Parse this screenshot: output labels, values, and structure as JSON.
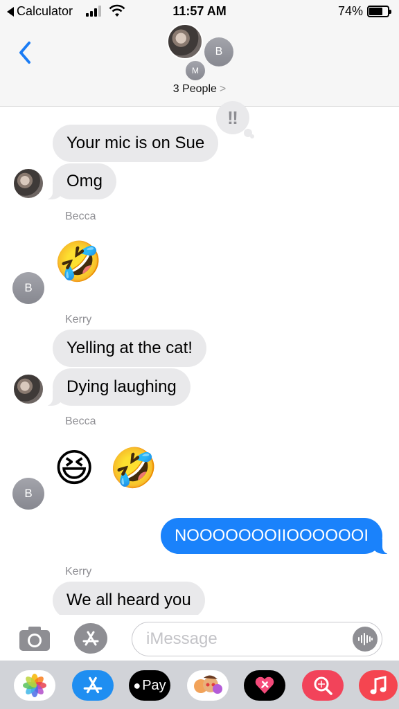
{
  "status_bar": {
    "back_app": "Calculator",
    "time": "11:57 AM",
    "battery": "74%"
  },
  "header": {
    "avatar_b": "B",
    "avatar_m": "M",
    "people": "3 People",
    "people_chevron": ">"
  },
  "messages": {
    "m1": "Your mic is on Sue",
    "m2": "Omg",
    "sender_becca_1": "Becca",
    "emoji_1": "🤣",
    "avatar_b_1": "B",
    "sender_kerry_1": "Kerry",
    "m3": "Yelling at the cat!",
    "m4": "Dying laughing",
    "sender_becca_2": "Becca",
    "emoji_2a": "😆",
    "emoji_2b": "🤣",
    "avatar_b_2": "B",
    "m5_out": "NOOOOOOOIIOOOOOOI",
    "sender_kerry_2": "Kerry",
    "m6": "We all heard you",
    "tapback": "‼"
  },
  "input": {
    "placeholder": "iMessage"
  },
  "drawer": {
    "apps": [
      "photos-app",
      "app-store-app",
      "apple-pay-app",
      "memoji-app",
      "digital-touch-app",
      "search-images-app",
      "music-app"
    ],
    "pay_label": "Pay"
  },
  "colors": {
    "outgoing_bubble": "#1a82fb",
    "incoming_bubble": "#e9e9eb",
    "ios_blue": "#1a7cf5"
  }
}
